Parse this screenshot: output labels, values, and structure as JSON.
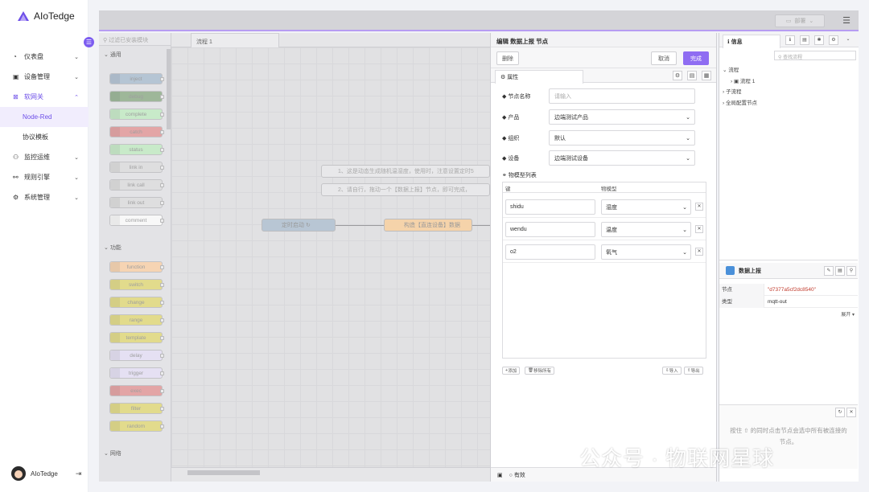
{
  "app": {
    "name": "AIoTedge"
  },
  "nav": {
    "items": [
      {
        "label": "仪表盘",
        "icon": "dashboard-icon"
      },
      {
        "label": "设备管理",
        "icon": "device-icon"
      },
      {
        "label": "软网关",
        "icon": "gateway-icon"
      },
      {
        "label": "监控运维",
        "icon": "monitor-icon"
      },
      {
        "label": "规则引擎",
        "icon": "rule-icon"
      },
      {
        "label": "系统管理",
        "icon": "settings-icon"
      }
    ],
    "subitems": [
      {
        "label": "Node-Red"
      },
      {
        "label": "协议模板"
      }
    ],
    "user": "AIoTedge"
  },
  "topbar": {
    "deploy_label": "部署"
  },
  "palette": {
    "filter_placeholder": "过滤已安装模块",
    "categories": [
      "通用",
      "功能",
      "网络"
    ],
    "common_nodes": [
      "inject",
      "debug",
      "complete",
      "catch",
      "status",
      "link in",
      "link call",
      "link out",
      "comment"
    ],
    "function_nodes": [
      "function",
      "switch",
      "change",
      "range",
      "template",
      "delay",
      "trigger",
      "exec",
      "filter",
      "random"
    ],
    "common_colors": [
      "#a6bbcf",
      "#87a980",
      "#c0edc0",
      "#e49191",
      "#c0edc0",
      "#dddddd",
      "#dddddd",
      "#dddddd",
      "#ffffff"
    ],
    "function_colors": [
      "#fdd0a2",
      "#e2d96e",
      "#e2d96e",
      "#e2d96e",
      "#e2d96e",
      "#e6e0f8",
      "#e6e0f8",
      "#e49191",
      "#e2d96e",
      "#e2d96e"
    ]
  },
  "workspace": {
    "tab": "流程 1",
    "comment1": "1、这是动态生成随机温湿度，使用时，注意设置定时5",
    "comment2": "2、请自行，拖动一个【数据上报】节点，即可完成，",
    "inject_node": "定时启动 ↻",
    "function_node": "构造【直连设备】数据"
  },
  "editor": {
    "title": "编辑 数据上报 节点",
    "delete": "删除",
    "cancel": "取消",
    "done": "完成",
    "tab": "属性",
    "fields": {
      "name_label": "节点名称",
      "name_placeholder": "请输入",
      "product_label": "产品",
      "product_value": "边端测试产品",
      "org_label": "组织",
      "org_value": "默认",
      "device_label": "设备",
      "device_value": "边端测试设备"
    },
    "model_list_label": "物模型列表",
    "table": {
      "col_key": "键",
      "col_model": "物模型",
      "rows": [
        {
          "key": "shidu",
          "model": "湿度"
        },
        {
          "key": "wendu",
          "model": "温度"
        },
        {
          "key": "o2",
          "model": "氧气"
        }
      ]
    },
    "add": "添加",
    "remove_all": "移除所有",
    "import": "导入",
    "export": "导出",
    "footer_status": "有效"
  },
  "sidebar": {
    "tab": "信息",
    "search_placeholder": "查找流程",
    "tree": [
      "流程",
      "流程 1",
      "子流程",
      "全局配置节点"
    ],
    "info_title": "数据上报",
    "info_rows": [
      {
        "k": "节点",
        "v": "\"d7377a5cf2dc8540\""
      },
      {
        "k": "类型",
        "v": "mqtt-out"
      }
    ],
    "expand": "展开",
    "hint": "按住 ⇧ 的同时点击节点会选中所有被连接的节点。"
  },
  "watermark": "公众号 · 物联网星球"
}
